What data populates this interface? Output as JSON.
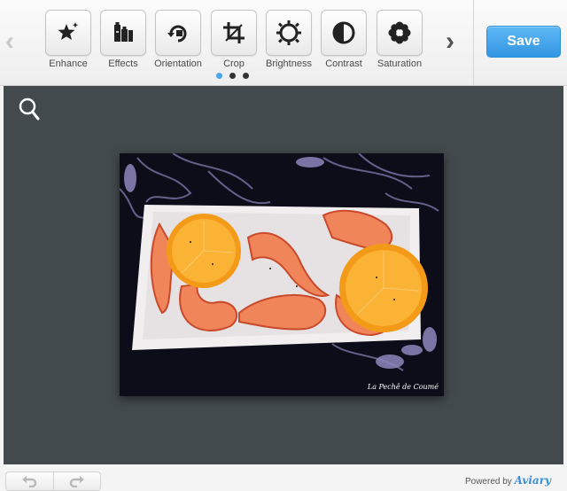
{
  "toolbar": {
    "tools": [
      {
        "label": "Enhance",
        "icon": "enhance-icon"
      },
      {
        "label": "Effects",
        "icon": "effects-icon"
      },
      {
        "label": "Orientation",
        "icon": "orientation-icon"
      },
      {
        "label": "Crop",
        "icon": "crop-icon"
      },
      {
        "label": "Brightness",
        "icon": "brightness-icon"
      },
      {
        "label": "Contrast",
        "icon": "contrast-icon"
      },
      {
        "label": "Saturation",
        "icon": "saturation-icon"
      }
    ],
    "prev_icon": "chevron-left-icon",
    "next_icon": "chevron-right-icon",
    "page_dots": 3,
    "active_page": 1,
    "save_label": "Save"
  },
  "canvas": {
    "zoom_icon": "magnifier-icon",
    "photo_watermark": "La Pechê de Coumé"
  },
  "footer": {
    "undo_icon": "undo-icon",
    "redo_icon": "redo-icon",
    "powered_by": "Powered by",
    "brand": "Aviary"
  },
  "colors": {
    "accent": "#3b9de6",
    "canvas_bg": "#424a4d"
  }
}
